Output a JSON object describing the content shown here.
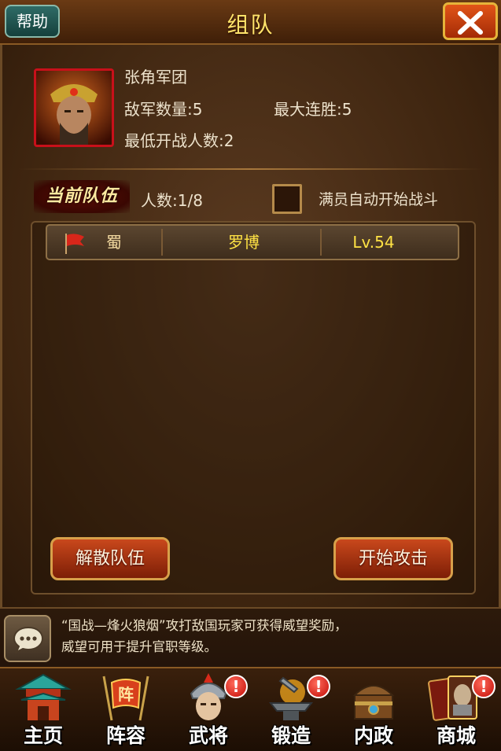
{
  "header": {
    "title": "组队",
    "help_label": "帮助"
  },
  "army": {
    "name": "张角军团",
    "enemy_count_label": "敌军数量:5",
    "max_streak_label": "最大连胜:5",
    "min_players_label": "最低开战人数:2"
  },
  "team": {
    "section_label": "当前队伍",
    "count_label": "人数:1/8",
    "auto_start_label": "满员自动开始战斗",
    "members": [
      {
        "faction": "蜀",
        "name": "罗博",
        "level": "Lv.54"
      }
    ]
  },
  "actions": {
    "disband_label": "解散队伍",
    "attack_label": "开始攻击"
  },
  "message": {
    "line1": "“国战—烽火狼烟”攻打敌国玩家可获得威望奖励，",
    "line2": "威望可用于提升官职等级。"
  },
  "nav": {
    "home": "主页",
    "formation": "阵容",
    "generals": "武将",
    "forge": "锻造",
    "internal": "内政",
    "shop": "商城",
    "formation_icon_char": "阵",
    "alert_glyph": "!"
  },
  "colors": {
    "accent": "#ffe36a",
    "button": "#c9481c",
    "panel": "#3d240f"
  }
}
